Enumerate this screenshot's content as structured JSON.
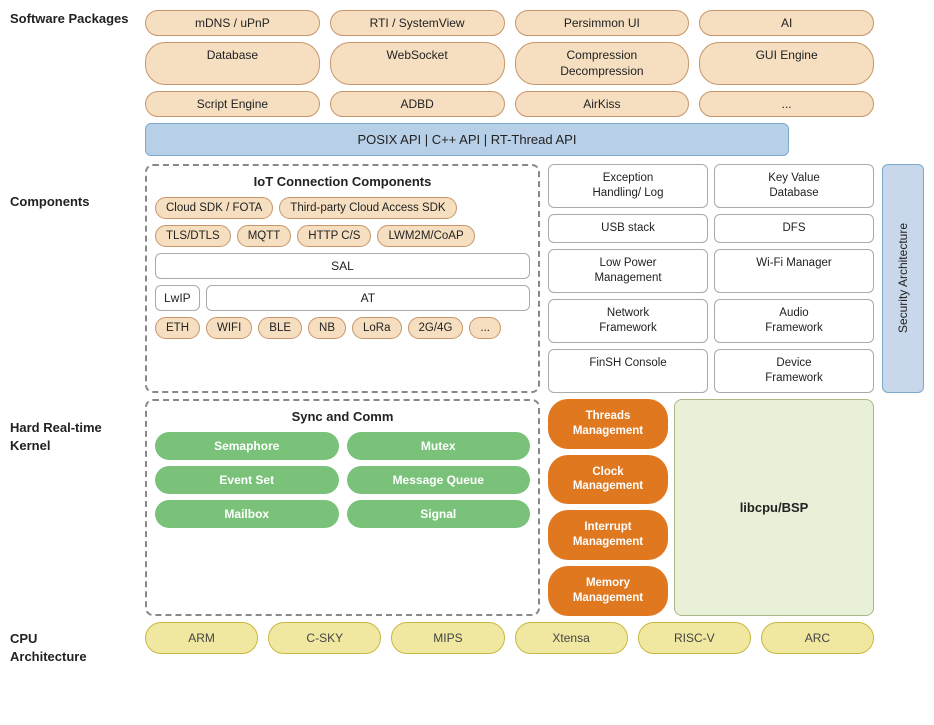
{
  "sections": {
    "software_packages_label": "Software\nPackages",
    "components_label": "Components",
    "kernel_label": "Hard Real-time\nKernel",
    "cpu_label": "CPU\nArchitecture"
  },
  "software_packages": {
    "row1": [
      "mDNS / uPnP",
      "RTI / SystemView",
      "Persimmon UI",
      "AI"
    ],
    "row2": [
      "Database",
      "WebSocket",
      "Compression\nDecompression",
      "GUI Engine"
    ],
    "row3": [
      "Script Engine",
      "ADBD",
      "AirKiss",
      "..."
    ]
  },
  "posix_bar": "POSIX API  |  C++ API  |  RT-Thread API",
  "iot_box": {
    "title": "IoT Connection Components",
    "row1": [
      "Cloud SDK / FOTA",
      "Third-party Cloud Access SDK"
    ],
    "row2": [
      "TLS/DTLS",
      "MQTT",
      "HTTP C/S",
      "LWM2M/CoAP"
    ],
    "sal": "SAL",
    "lwip": "LwIP",
    "at": "AT",
    "protocol_row": [
      "ETH",
      "WIFI",
      "BLE",
      "NB",
      "LoRa",
      "2G/4G",
      "..."
    ]
  },
  "right_components": [
    "Exception\nHandling/ Log",
    "Key Value\nDatabase",
    "USB stack",
    "DFS",
    "Low Power\nManagement",
    "Wi-Fi Manager",
    "Network\nFramework",
    "Audio\nFramework",
    "FinSH Console",
    "Device\nFramework"
  ],
  "security_arch": "Security Architecture",
  "sync_box": {
    "title": "Sync and Comm",
    "row1": [
      "Semaphore",
      "Mutex"
    ],
    "row2": [
      "Event Set",
      "Message Queue"
    ],
    "row3": [
      "Mailbox",
      "Signal"
    ]
  },
  "kernel_right": {
    "orange": [
      "Threads\nManagement",
      "Clock Management",
      "Interrupt\nManagement",
      "Memory\nManagement"
    ],
    "libcpu": "libcpu/BSP"
  },
  "cpu_chips": [
    "ARM",
    "C-SKY",
    "MIPS",
    "Xtensa",
    "RISC-V",
    "ARC"
  ]
}
